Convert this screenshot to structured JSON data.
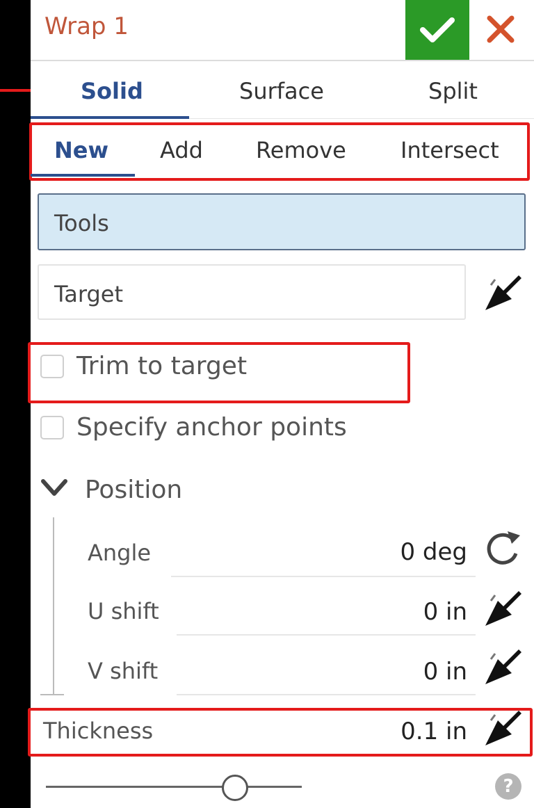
{
  "dialog": {
    "title": "Wrap 1",
    "ok_icon": "checkmark-icon",
    "cancel_icon": "close-icon"
  },
  "tabs_level1": [
    {
      "label": "Solid",
      "selected": true
    },
    {
      "label": "Surface",
      "selected": false
    },
    {
      "label": "Split",
      "selected": false
    }
  ],
  "tabs_level2": [
    {
      "label": "New",
      "selected": true
    },
    {
      "label": "Add",
      "selected": false
    },
    {
      "label": "Remove",
      "selected": false
    },
    {
      "label": "Intersect",
      "selected": false
    }
  ],
  "fields": {
    "tools": "Tools",
    "target": "Target"
  },
  "checkboxes": {
    "trim_to_target": {
      "label": "Trim to target",
      "checked": false
    },
    "anchor_points": {
      "label": "Specify anchor points",
      "checked": false
    }
  },
  "position": {
    "label": "Position",
    "angle": {
      "label": "Angle",
      "value": "0 deg"
    },
    "u_shift": {
      "label": "U shift",
      "value": "0 in"
    },
    "v_shift": {
      "label": "V shift",
      "value": "0 in"
    }
  },
  "thickness": {
    "label": "Thickness",
    "value": "0.1 in"
  },
  "slider": {
    "position_fraction": 0.74
  },
  "help": "?",
  "colors": {
    "accent_blue": "#2c4f8e",
    "ok_green": "#2b9a27",
    "title_orange": "#c0563a",
    "annotation_red": "#e41b1b",
    "field_highlight": "#d6e9f5"
  }
}
